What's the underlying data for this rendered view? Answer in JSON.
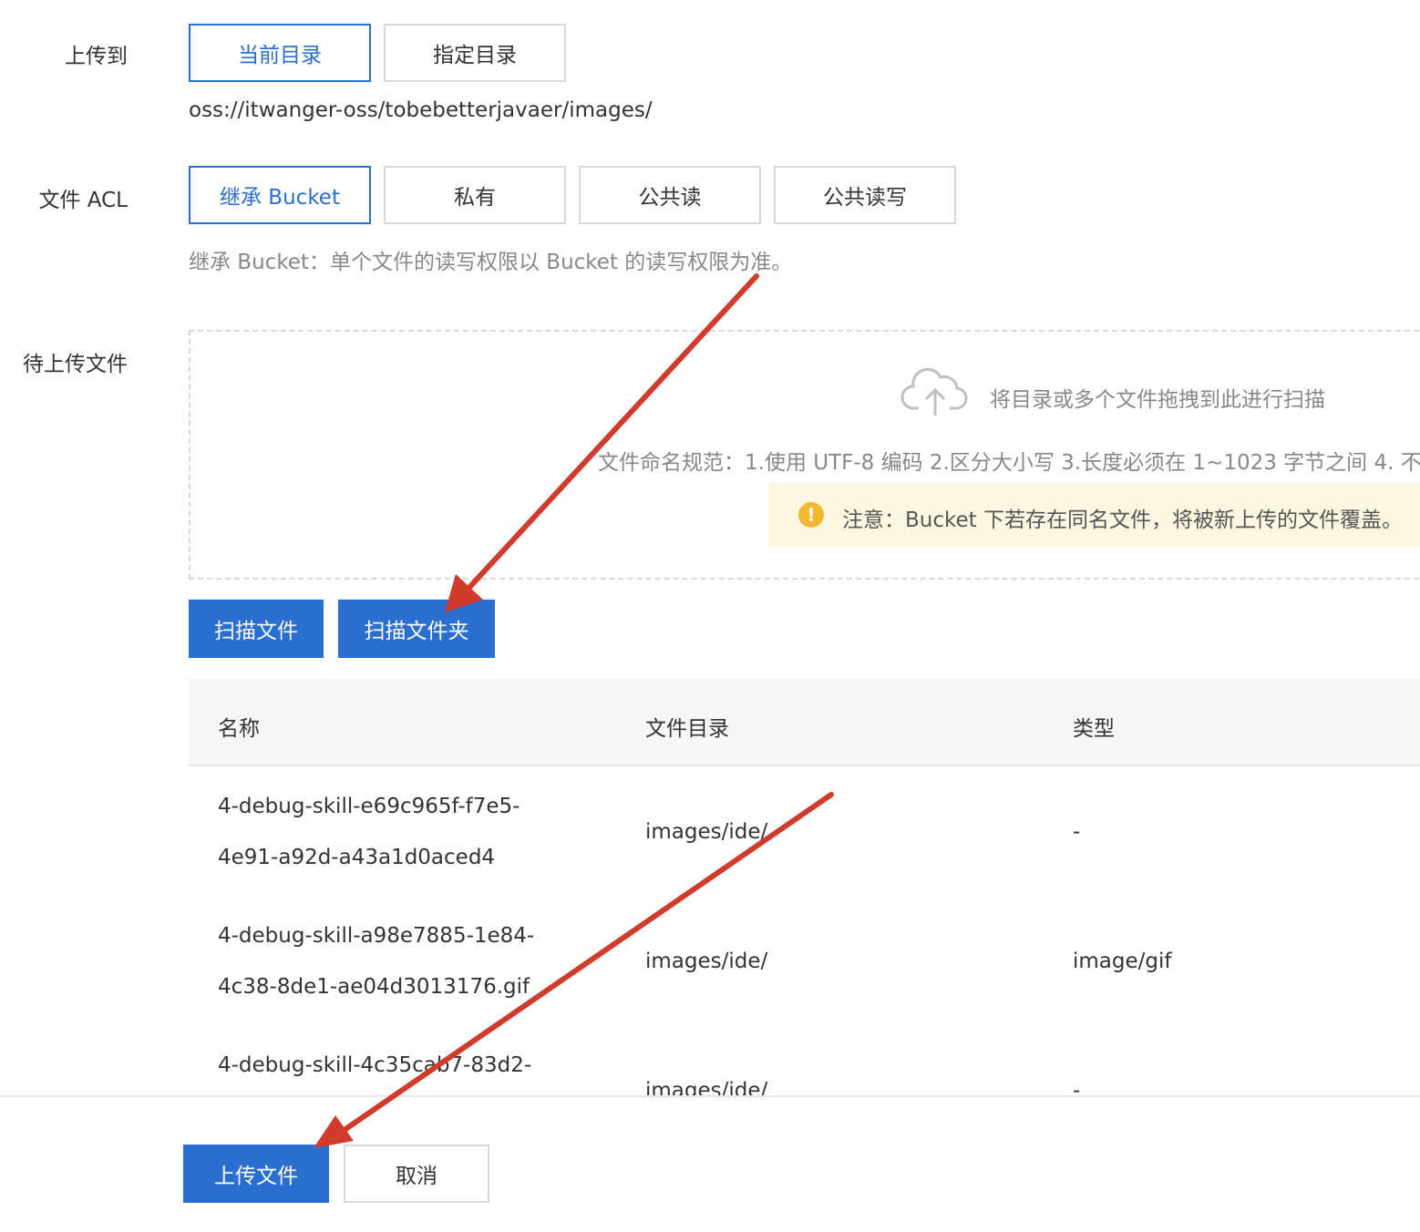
{
  "upload_to": {
    "label": "上传到",
    "options": [
      "当前目录",
      "指定目录"
    ],
    "selected": "当前目录",
    "path": "oss://itwanger-oss/tobebetterjavaer/images/"
  },
  "acl": {
    "label": "文件 ACL",
    "options": [
      "继承 Bucket",
      "私有",
      "公共读",
      "公共读写"
    ],
    "selected": "继承 Bucket",
    "hint": "继承 Bucket：单个文件的读写权限以 Bucket 的读写权限为准。"
  },
  "pending": {
    "label": "待上传文件",
    "drop_text": "将目录或多个文件拖拽到此进行扫描",
    "naming_rule": "文件命名规范：1.使用 UTF-8 编码 2.区分大小写 3.长度必须在 1~1023 字节之间 4. 不",
    "warning": "注意：Bucket 下若存在同名文件，将被新上传的文件覆盖。",
    "scan_file_label": "扫描文件",
    "scan_folder_label": "扫描文件夹"
  },
  "table": {
    "headers": [
      "名称",
      "文件目录",
      "类型"
    ],
    "rows": [
      {
        "name_line1": "4-debug-skill-e69c965f-f7e5-",
        "name_line2": "4e91-a92d-a43a1d0aced4",
        "dir": "images/ide/",
        "type": "-"
      },
      {
        "name_line1": "4-debug-skill-a98e7885-1e84-",
        "name_line2": "4c38-8de1-ae04d3013176.gif",
        "dir": "images/ide/",
        "type": "image/gif"
      },
      {
        "name_line1": "4-debug-skill-4c35cab7-83d2-",
        "name_line2": "",
        "dir": "images/ide/",
        "type": "-"
      }
    ]
  },
  "footer": {
    "upload_label": "上传文件",
    "cancel_label": "取消"
  },
  "colors": {
    "primary": "#2a6fd0",
    "annotation_arrow": "#d03b2b",
    "warning_bg": "#fdf6e0",
    "warning_icon": "#f5b630"
  },
  "icons": {
    "upload": "cloud-upload-icon",
    "warning": "exclamation-circle-icon"
  }
}
